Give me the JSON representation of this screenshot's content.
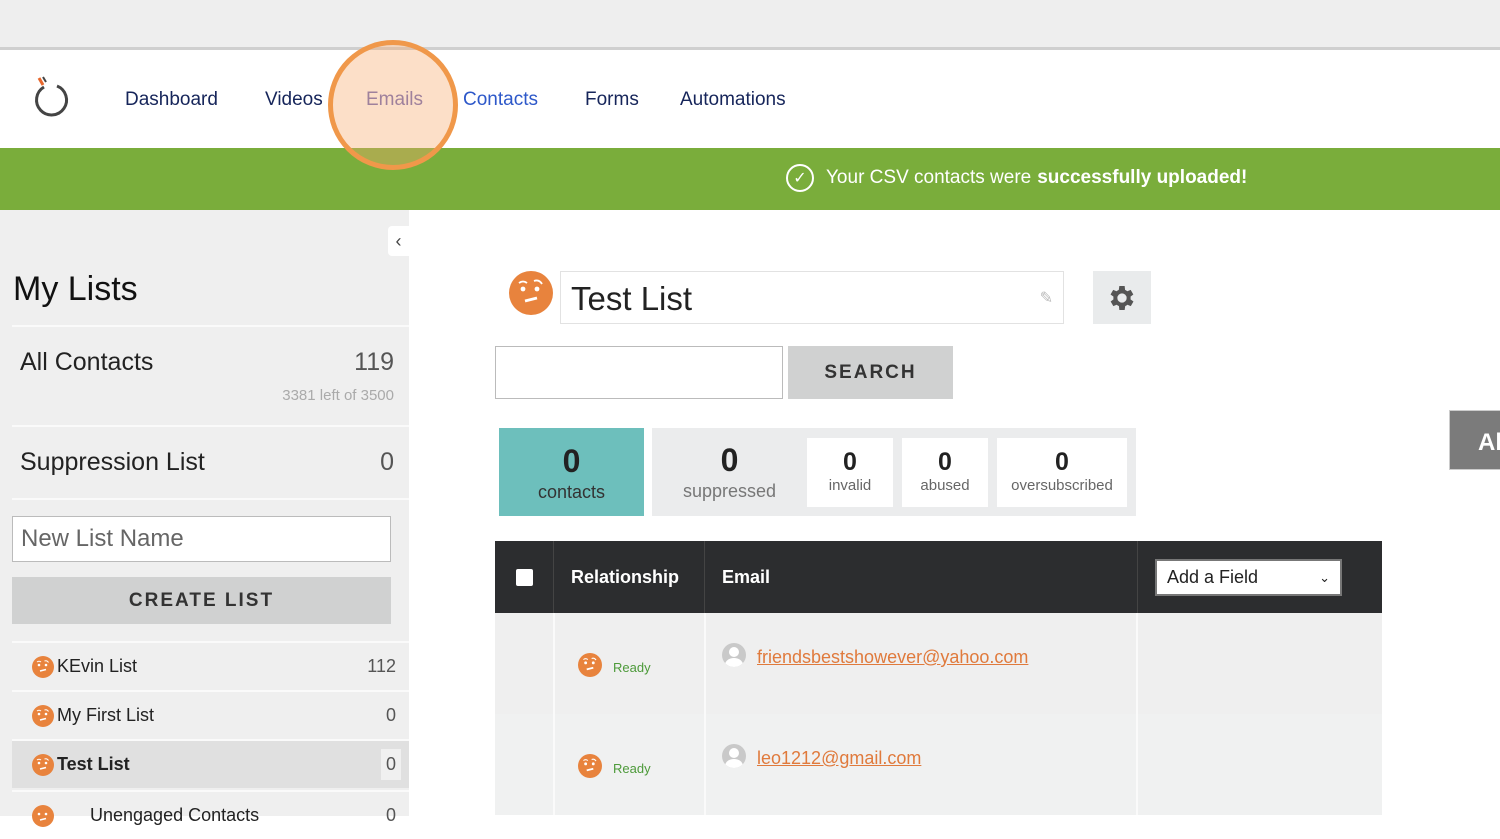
{
  "nav": {
    "items": [
      {
        "label": "Dashboard",
        "state": "default"
      },
      {
        "label": "Videos",
        "state": "default"
      },
      {
        "label": "Emails",
        "state": "active"
      },
      {
        "label": "Contacts",
        "state": "hover"
      },
      {
        "label": "Forms",
        "state": "default"
      },
      {
        "label": "Automations",
        "state": "default"
      }
    ]
  },
  "banner": {
    "text": "Your CSV contacts were",
    "bold_text": "successfully uploaded!",
    "icon": "check-circle-icon",
    "color": "#7aad3b"
  },
  "sidebar": {
    "title": "My Lists",
    "collapse_icon": "‹",
    "all_contacts": {
      "label": "All Contacts",
      "count": "119",
      "sub": "3381 left of 3500"
    },
    "suppression": {
      "label": "Suppression List",
      "count": "0"
    },
    "new_list_placeholder": "New List Name",
    "create_label": "CREATE LIST",
    "lists": [
      {
        "name": "KEvin List",
        "count": "112",
        "selected": false
      },
      {
        "name": "My First List",
        "count": "0",
        "selected": false
      },
      {
        "name": "Test List",
        "count": "0",
        "selected": true
      },
      {
        "name": "Unengaged Contacts",
        "count": "0",
        "selected": false
      }
    ]
  },
  "main": {
    "list_title": "Test List",
    "search_value": "",
    "search_label": "SEARCH",
    "stats": {
      "contacts": {
        "value": "0",
        "label": "contacts"
      },
      "suppressed": {
        "value": "0",
        "label": "suppressed"
      },
      "invalid": {
        "value": "0",
        "label": "invalid"
      },
      "abused": {
        "value": "0",
        "label": "abused"
      },
      "oversubscribed": {
        "value": "0",
        "label": "oversubscribed"
      }
    },
    "table": {
      "columns": [
        "Relationship",
        "Email"
      ],
      "add_field_label": "Add a Field",
      "rows": [
        {
          "relationship": "Ready",
          "email": "friendsbestshowever@yahoo.com"
        },
        {
          "relationship": "Ready",
          "email": "leo1212@gmail.com"
        }
      ]
    },
    "side_tab_label": "Al"
  },
  "colors": {
    "accent_orange": "#e8833d",
    "teal": "#6dbfbc",
    "nav_dark": "#16255a",
    "ready_green": "#4d9a3a"
  }
}
